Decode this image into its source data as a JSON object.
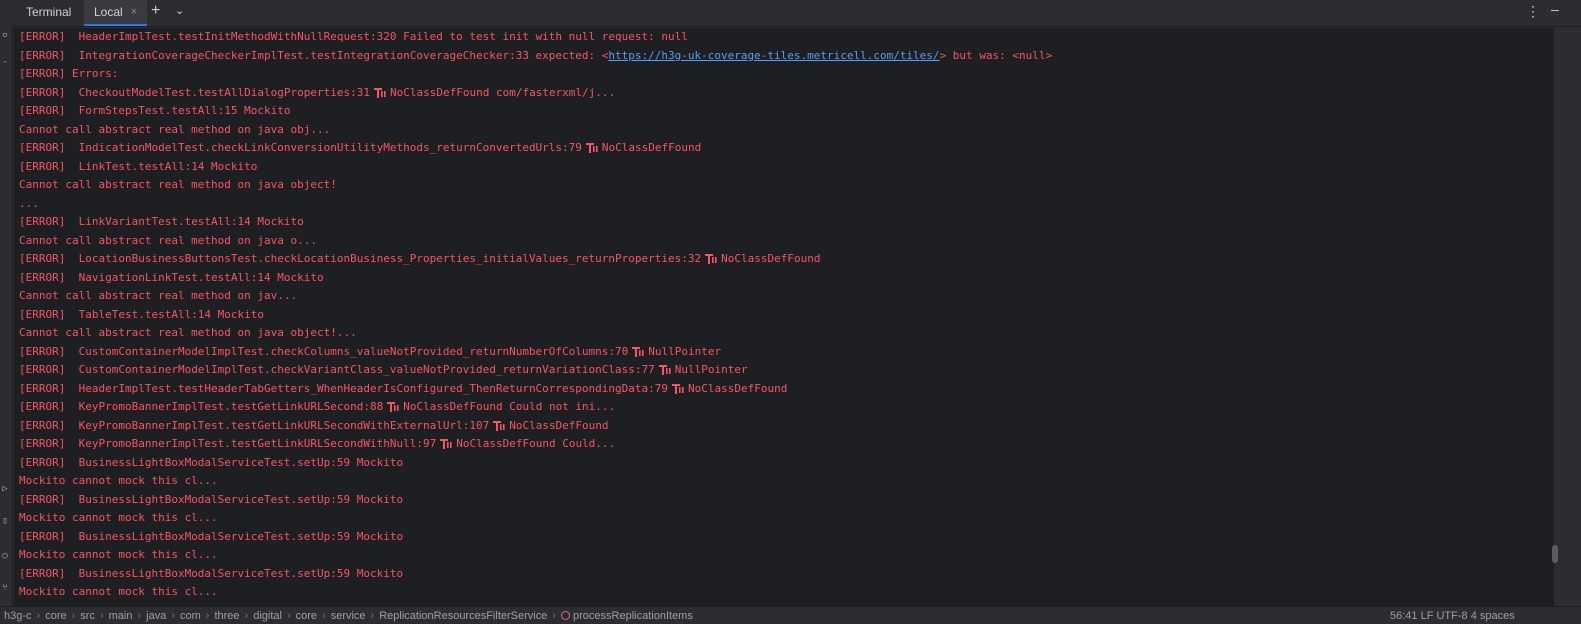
{
  "tabbar": {
    "title": "Terminal",
    "tab_label": "Local",
    "close_glyph": "×",
    "add_glyph": "+",
    "chevron_glyph": "⌄",
    "menu_glyph": "⋮",
    "minimize_glyph": "–"
  },
  "colors": {
    "error": "#f75464",
    "link": "#589df6",
    "background": "#1e1f22"
  },
  "icons": {
    "error_marker": "error-marker-icon"
  },
  "terminal": {
    "lines": [
      {
        "level": "[ERROR]",
        "text": "  HeaderImplTest.testInitMethodWithNullRequest:320 Failed to test init with null request: null"
      },
      {
        "level": "[ERROR]",
        "text": "  IntegrationCoverageCheckerImplTest.testIntegrationCoverageChecker:33 expected: <",
        "link": "https://h3g-uk-coverage-tiles.metricell.com/tiles/",
        "suffix": "> but was: <null>"
      },
      {
        "level": "[ERROR]",
        "text": " Errors:"
      },
      {
        "level": "[ERROR]",
        "text": "  CheckoutModelTest.testAllDialogProperties:31",
        "icon": true,
        "suffix": "NoClassDefFound com/fasterxml/j..."
      },
      {
        "level": "[ERROR]",
        "text": "  FormStepsTest.testAll:15 Mockito"
      },
      {
        "text": "Cannot call abstract real method on java obj..."
      },
      {
        "level": "[ERROR]",
        "text": "  IndicationModelTest.checkLinkConversionUtilityMethods_returnConvertedUrls:79",
        "icon": true,
        "suffix": "NoClassDefFound"
      },
      {
        "level": "[ERROR]",
        "text": "  LinkTest.testAll:14 Mockito"
      },
      {
        "text": "Cannot call abstract real method on java object!"
      },
      {
        "text": "..."
      },
      {
        "level": "[ERROR]",
        "text": "  LinkVariantTest.testAll:14 Mockito"
      },
      {
        "text": "Cannot call abstract real method on java o..."
      },
      {
        "level": "[ERROR]",
        "text": "  LocationBusinessButtonsTest.checkLocationBusiness_Properties_initialValues_returnProperties:32",
        "icon": true,
        "suffix": "NoClassDefFound"
      },
      {
        "level": "[ERROR]",
        "text": "  NavigationLinkTest.testAll:14 Mockito"
      },
      {
        "text": "Cannot call abstract real method on jav..."
      },
      {
        "level": "[ERROR]",
        "text": "  TableTest.testAll:14 Mockito"
      },
      {
        "text": "Cannot call abstract real method on java object!..."
      },
      {
        "level": "[ERROR]",
        "text": "  CustomContainerModelImplTest.checkColumns_valueNotProvided_returnNumberOfColumns:70",
        "icon": true,
        "suffix": "NullPointer"
      },
      {
        "level": "[ERROR]",
        "text": "  CustomContainerModelImplTest.checkVariantClass_valueNotProvided_returnVariationClass:77",
        "icon": true,
        "suffix": "NullPointer"
      },
      {
        "level": "[ERROR]",
        "text": "  HeaderImplTest.testHeaderTabGetters_WhenHeaderIsConfigured_ThenReturnCorrespondingData:79",
        "icon": true,
        "suffix": "NoClassDefFound"
      },
      {
        "level": "[ERROR]",
        "text": "  KeyPromoBannerImplTest.testGetLinkURLSecond:88",
        "icon": true,
        "suffix": "NoClassDefFound Could not ini..."
      },
      {
        "level": "[ERROR]",
        "text": "  KeyPromoBannerImplTest.testGetLinkURLSecondWithExternalUrl:107",
        "icon": true,
        "suffix": "NoClassDefFound"
      },
      {
        "level": "[ERROR]",
        "text": "  KeyPromoBannerImplTest.testGetLinkURLSecondWithNull:97",
        "icon": true,
        "suffix": "NoClassDefFound Could..."
      },
      {
        "level": "[ERROR]",
        "text": "  BusinessLightBoxModalServiceTest.setUp:59 Mockito"
      },
      {
        "text": "Mockito cannot mock this cl..."
      },
      {
        "level": "[ERROR]",
        "text": "  BusinessLightBoxModalServiceTest.setUp:59 Mockito"
      },
      {
        "text": "Mockito cannot mock this cl..."
      },
      {
        "level": "[ERROR]",
        "text": "  BusinessLightBoxModalServiceTest.setUp:59 Mockito"
      },
      {
        "text": "Mockito cannot mock this cl..."
      },
      {
        "level": "[ERROR]",
        "text": "  BusinessLightBoxModalServiceTest.setUp:59 Mockito"
      },
      {
        "text": "Mockito cannot mock this cl..."
      }
    ]
  },
  "statusbar": {
    "crumbs": [
      "h3g-c",
      "core",
      "src",
      "main",
      "java",
      "com",
      "three",
      "digital",
      "core",
      "service",
      "ReplicationResourcesFilterService",
      "processReplicationItems"
    ],
    "right": "56:41   LF   UTF-8   4 spaces"
  }
}
